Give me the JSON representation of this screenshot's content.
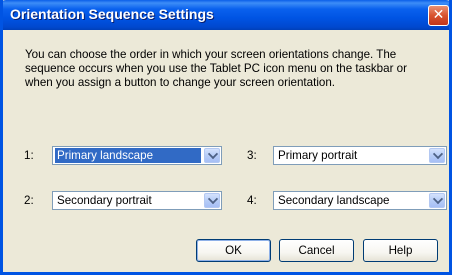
{
  "window": {
    "title": "Orientation Sequence Settings",
    "close_glyph": "✕",
    "accent": "#0054e3"
  },
  "description": "You can choose the order in which your screen orientations change. The sequence occurs when you use the Tablet PC icon menu on the taskbar or when you assign a button to change your screen orientation.",
  "sequence": [
    {
      "number": "1:",
      "value": "Primary landscape",
      "selected": true
    },
    {
      "number": "2:",
      "value": "Secondary portrait"
    },
    {
      "number": "3:",
      "value": "Primary portrait"
    },
    {
      "number": "4:",
      "value": "Secondary landscape"
    }
  ],
  "buttons": {
    "ok": "OK",
    "cancel": "Cancel",
    "help": "Help"
  }
}
